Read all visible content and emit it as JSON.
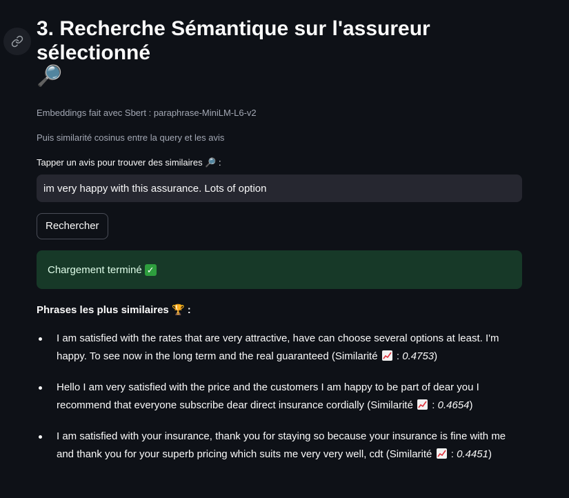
{
  "header": {
    "title": "3. Recherche Sémantique sur l'assureur sélectionné",
    "title_emoji": "🔎"
  },
  "captions": {
    "embeddings": "Embeddings fait avec Sbert : paraphrase-MiniLM-L6-v2",
    "similarity": "Puis similarité cosinus entre la query et les avis"
  },
  "search": {
    "label": "Tapper un avis pour trouver des similaires 🔎 :",
    "value": "im very happy with this assurance. Lots of option",
    "button_label": "Rechercher"
  },
  "status": {
    "message": "Chargement terminé",
    "check_glyph": "✓",
    "color": "#173928"
  },
  "results": {
    "title": "Phrases les plus similaires 🏆 :",
    "similarity_label_prefix": "(Similarité",
    "items": [
      {
        "text": "I am satisfied with the rates that are very attractive, have can choose several options at least. I'm happy. To see now in the long term and the real guaranteed",
        "score": "0.4753"
      },
      {
        "text": "Hello I am very satisfied with the price and the customers I am happy to be part of dear you I recommend that everyone subscribe dear direct insurance cordially",
        "score": "0.4654"
      },
      {
        "text": "I am satisfied with your insurance, thank you for staying so because your insurance is fine with me and thank you for your superb pricing which suits me very very well, cdt",
        "score": "0.4451"
      }
    ]
  },
  "icons": {
    "anchor": "link-icon",
    "chart": "chart-increasing-icon"
  }
}
